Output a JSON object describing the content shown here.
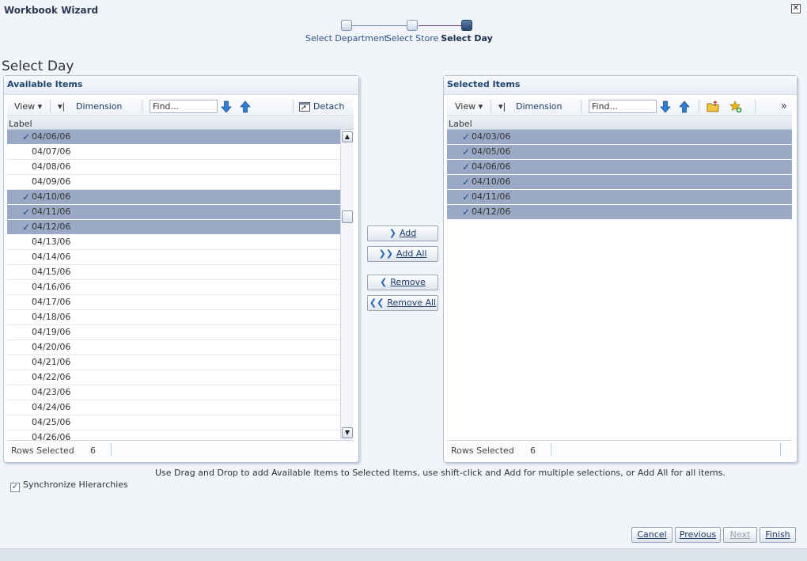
{
  "window": {
    "title": "Workbook Wizard"
  },
  "train": {
    "steps": [
      {
        "label": "Select Department"
      },
      {
        "label": "Select Store"
      },
      {
        "label": "Select Day"
      }
    ]
  },
  "page_title": "Select Day",
  "available": {
    "header": "Available Items",
    "toolbar": {
      "view": "View ▾",
      "dimension": "Dimension",
      "find_value": "Find...",
      "detach": "Detach"
    },
    "column": "Label",
    "rows": [
      {
        "label": "04/06/06",
        "selected": true
      },
      {
        "label": "04/07/06",
        "selected": false
      },
      {
        "label": "04/08/06",
        "selected": false
      },
      {
        "label": "04/09/06",
        "selected": false
      },
      {
        "label": "04/10/06",
        "selected": true
      },
      {
        "label": "04/11/06",
        "selected": true
      },
      {
        "label": "04/12/06",
        "selected": true
      },
      {
        "label": "04/13/06",
        "selected": false
      },
      {
        "label": "04/14/06",
        "selected": false
      },
      {
        "label": "04/15/06",
        "selected": false
      },
      {
        "label": "04/16/06",
        "selected": false
      },
      {
        "label": "04/17/06",
        "selected": false
      },
      {
        "label": "04/18/06",
        "selected": false
      },
      {
        "label": "04/19/06",
        "selected": false
      },
      {
        "label": "04/20/06",
        "selected": false
      },
      {
        "label": "04/21/06",
        "selected": false
      },
      {
        "label": "04/22/06",
        "selected": false
      },
      {
        "label": "04/23/06",
        "selected": false
      },
      {
        "label": "04/24/06",
        "selected": false
      },
      {
        "label": "04/25/06",
        "selected": false
      },
      {
        "label": "04/26/06",
        "selected": false
      }
    ],
    "status_label": "Rows Selected",
    "status_count": "6"
  },
  "selected": {
    "header": "Selected Items",
    "toolbar": {
      "view": "View ▾",
      "dimension": "Dimension",
      "find_value": "Find..."
    },
    "column": "Label",
    "rows": [
      {
        "label": "04/03/06",
        "selected": true
      },
      {
        "label": "04/05/06",
        "selected": true
      },
      {
        "label": "04/06/06",
        "selected": true
      },
      {
        "label": "04/10/06",
        "selected": true
      },
      {
        "label": "04/11/06",
        "selected": true
      },
      {
        "label": "04/12/06",
        "selected": true
      }
    ],
    "status_label": "Rows Selected",
    "status_count": "6"
  },
  "shuttle": {
    "add": "Add",
    "add_all": "Add All",
    "remove": "Remove",
    "remove_all": "Remove All"
  },
  "instructions": "Use Drag and Drop to add Available Items to Selected Items, use shift-click and Add for multiple selections, or Add All for all items.",
  "sync_label": "Synchronize Hierarchies",
  "footer": {
    "cancel": "Cancel",
    "previous": "Previous",
    "next": "Next",
    "finish": "Finish"
  },
  "colors": {
    "selected_row": "#9aa9c5",
    "header_text": "#22466e",
    "accent_blue": "#2b66b1"
  }
}
